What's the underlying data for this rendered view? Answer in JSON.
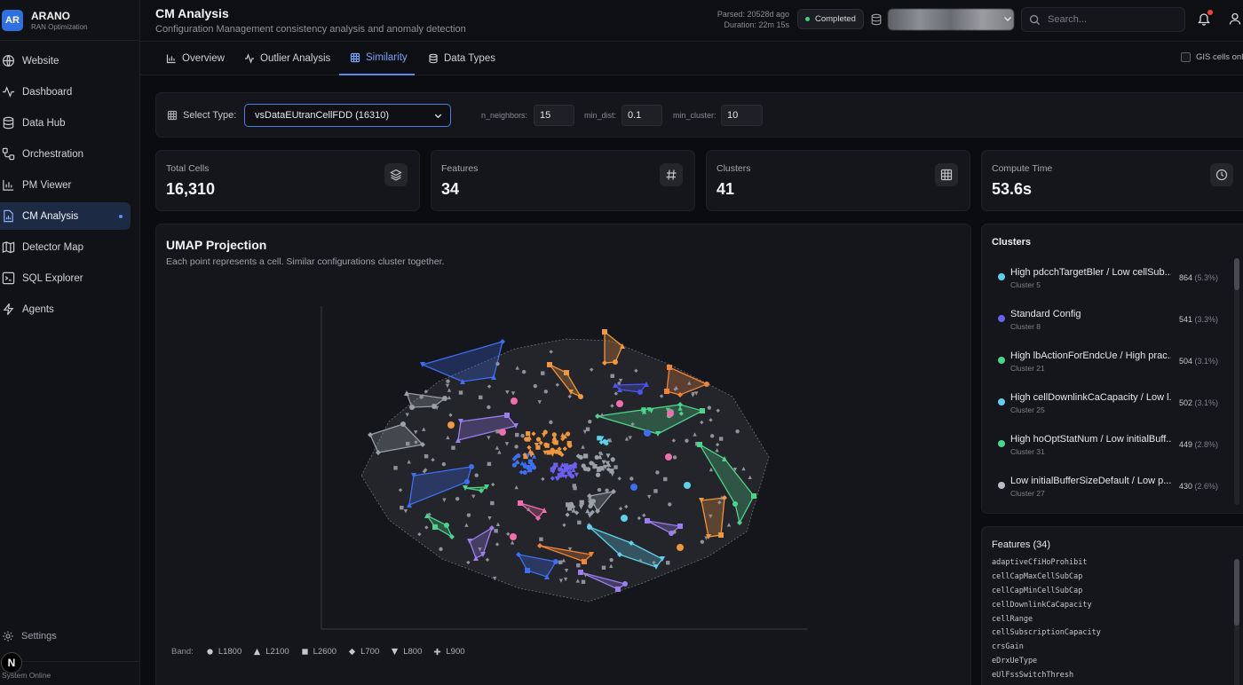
{
  "brand": {
    "logo": "AR",
    "name": "ARANO",
    "subtitle": "RAN Optimization"
  },
  "sidebar": {
    "items": [
      {
        "label": "Website",
        "icon": "globe-icon",
        "active": false
      },
      {
        "label": "Dashboard",
        "icon": "activity-icon",
        "active": false
      },
      {
        "label": "Data Hub",
        "icon": "database-icon",
        "active": false
      },
      {
        "label": "Orchestration",
        "icon": "workflow-icon",
        "active": false
      },
      {
        "label": "PM Viewer",
        "icon": "bar-chart-icon",
        "active": false
      },
      {
        "label": "CM Analysis",
        "icon": "file-chart-icon",
        "active": true
      },
      {
        "label": "Detector Map",
        "icon": "map-icon",
        "active": false
      },
      {
        "label": "SQL Explorer",
        "icon": "terminal-icon",
        "active": false
      },
      {
        "label": "Agents",
        "icon": "zap-icon",
        "active": false
      }
    ],
    "settings_label": "Settings",
    "status_text": "System Online",
    "n_badge": "N"
  },
  "header": {
    "title": "CM Analysis",
    "subtitle": "Configuration Management consistency analysis and anomaly detection",
    "parsed": "Parsed: 20528d ago",
    "duration": "Duration: 22m 15s",
    "status": "Completed",
    "search_placeholder": "Search..."
  },
  "tabs": [
    {
      "label": "Overview",
      "icon": "bar-chart-icon",
      "active": false
    },
    {
      "label": "Outlier Analysis",
      "icon": "activity-icon",
      "active": false
    },
    {
      "label": "Similarity",
      "icon": "grid-icon",
      "active": true
    },
    {
      "label": "Data Types",
      "icon": "database-icon",
      "active": false
    }
  ],
  "gis_label": "GIS cells only",
  "controls": {
    "select_type_label": "Select Type:",
    "selected_type": "vsDataEUtranCellFDD (16310)",
    "n_neighbors_label": "n_neighbors:",
    "n_neighbors": "15",
    "min_dist_label": "min_dist:",
    "min_dist": "0.1",
    "min_cluster_label": "min_cluster:",
    "min_cluster": "10"
  },
  "stats": [
    {
      "label": "Total Cells",
      "value": "16,310",
      "icon": "layers-icon"
    },
    {
      "label": "Features",
      "value": "34",
      "icon": "hash-icon"
    },
    {
      "label": "Clusters",
      "value": "41",
      "icon": "grid-icon"
    },
    {
      "label": "Compute Time",
      "value": "53.6s",
      "icon": "clock-icon"
    }
  ],
  "umap": {
    "title": "UMAP Projection",
    "subtitle": "Each point represents a cell. Similar configurations cluster together."
  },
  "legend": {
    "label": "Band:",
    "items": [
      {
        "label": "L1800",
        "shape": "circle"
      },
      {
        "label": "L2100",
        "shape": "triangle-up"
      },
      {
        "label": "L2600",
        "shape": "square"
      },
      {
        "label": "L700",
        "shape": "diamond"
      },
      {
        "label": "L800",
        "shape": "triangle-down"
      },
      {
        "label": "L900",
        "shape": "plus"
      }
    ]
  },
  "clusters_panel": {
    "title": "Clusters",
    "items": [
      {
        "name": "High pdcchTargetBler / Low cellSub...",
        "sub": "Cluster 5",
        "count": "864",
        "pct": "(5.3%)",
        "color": "#5fd0ea"
      },
      {
        "name": "Standard Config",
        "sub": "Cluster 8",
        "count": "541",
        "pct": "(3.3%)",
        "color": "#6a5ff0"
      },
      {
        "name": "High lbActionForEndcUe / High prac...",
        "sub": "Cluster 21",
        "count": "504",
        "pct": "(3.1%)",
        "color": "#4cd48a"
      },
      {
        "name": "High cellDownlinkCaCapacity / Low l...",
        "sub": "Cluster 25",
        "count": "502",
        "pct": "(3.1%)",
        "color": "#5fd0ea"
      },
      {
        "name": "High hoOptStatNum / Low initialBuff...",
        "sub": "Cluster 31",
        "count": "449",
        "pct": "(2.8%)",
        "color": "#4cd48a"
      },
      {
        "name": "Low initialBufferSizeDefault / Low p...",
        "sub": "Cluster 27",
        "count": "430",
        "pct": "(2.6%)",
        "color": "#b9bcc3"
      }
    ]
  },
  "features_panel": {
    "title": "Features (34)",
    "items": [
      "adaptiveCfiHoProhibit",
      "cellCapMaxCellSubCap",
      "cellCapMinCellSubCap",
      "cellDownlinkCaCapacity",
      "cellRange",
      "cellSubscriptionCapacity",
      "crsGain",
      "eDrxUeType",
      "eUlFssSwitchThresh"
    ]
  },
  "colors": {
    "accent": "#5b8bf0",
    "status_ok": "#3fcf7e",
    "notification": "#f0443a"
  }
}
